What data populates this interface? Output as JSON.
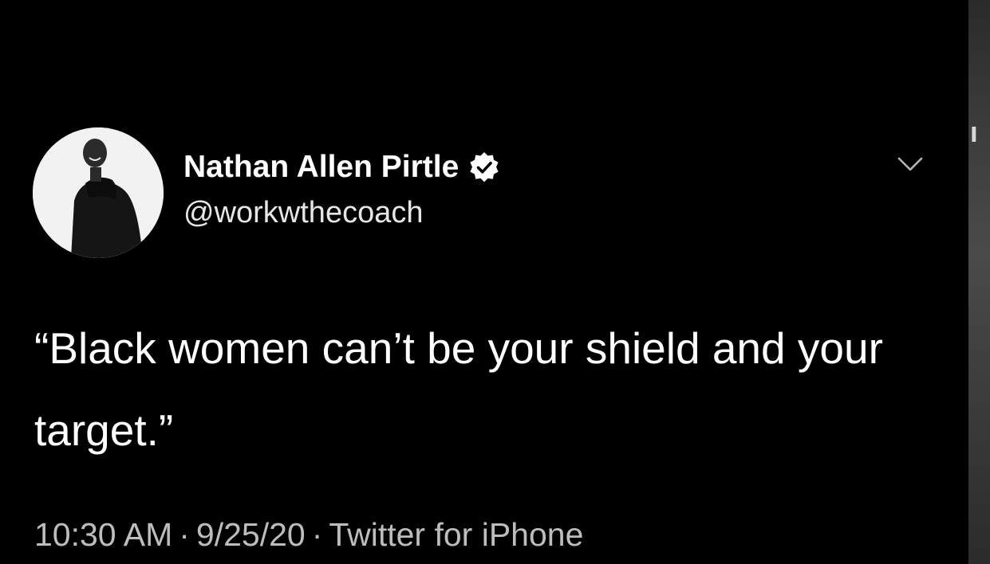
{
  "tweet": {
    "display_name": "Nathan Allen Pirtle",
    "handle": "@workwthecoach",
    "text": "“Black women can’t be your shield and your target.”",
    "time": "10:30 AM",
    "date": "9/25/20",
    "source": "Twitter for iPhone",
    "separator": "·"
  },
  "icons": {
    "verified": "verified-badge-icon",
    "more": "chevron-down-icon"
  },
  "colors": {
    "background": "#000000",
    "text": "#ffffff",
    "secondary_text": "#bdbdbd"
  }
}
